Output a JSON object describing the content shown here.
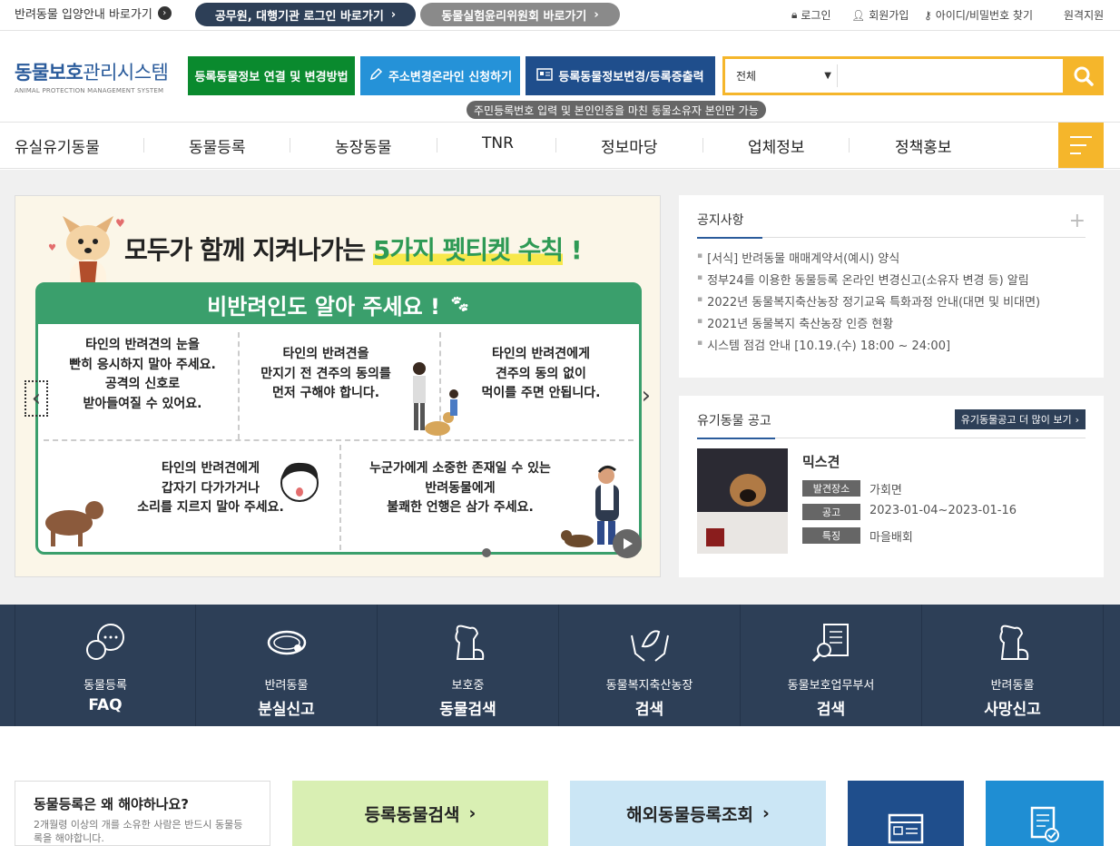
{
  "topbar": {
    "adopt_link": "반려동물 입양안내 바로가기",
    "pill_official": "공무원, 대행기관 로그인 바로가기",
    "pill_ethics": "동물실험윤리위원회 바로가기",
    "login": "로그인",
    "signup": "회원가입",
    "find": "아이디/비밀번호 찾기",
    "remote": "원격지원"
  },
  "header": {
    "logo_main_bold": "동물보호",
    "logo_main_rest": "관리시스템",
    "logo_sub": "ANIMAL PROTECTION MANAGEMENT SYSTEM",
    "btn_connect": "등록동물정보 연결 및 변경방법",
    "btn_address": "주소변경온라인 신청하기",
    "btn_change": "등록동물정보변경/등록증출력",
    "search_select": "전체",
    "search_placeholder": "",
    "hint": "주민등록번호 입력 및 본인인증을 마친 동물소유자 본인만 가능",
    "colors": {
      "green": "#0a8a2e",
      "blue": "#2592d8",
      "navy": "#1f4e8c",
      "yellow": "#f5b62b"
    }
  },
  "nav": [
    "유실유기동물",
    "동물등록",
    "농장동물",
    "TNR",
    "정보마당",
    "업체정보",
    "정책홍보"
  ],
  "banner": {
    "title_pre": "모두가 함께 지켜나가는",
    "title_hl": "5가지 펫티켓 수칙",
    "title_post": "!",
    "head": "비반려인도 알아 주세요 !",
    "cells": [
      "타인의 반려견의 눈을\n빤히 응시하지 말아 주세요.\n공격의 신호로\n받아들여질 수 있어요.",
      "타인의 반려견을\n만지기 전 견주의 동의를\n먼저 구해야 합니다.",
      "타인의 반려견에게\n견주의 동의 없이\n먹이를 주면 안됩니다.",
      "타인의 반려견에게\n갑자기 다가가거나\n소리를 지르지 말아 주세요.",
      "누군가에게 소중한 존재일 수 있는\n반려동물에게\n불쾌한 언행은 삼가 주세요."
    ]
  },
  "notice": {
    "title": "공지사항",
    "items": [
      "[서식] 반려동물 매매계약서(예시) 양식",
      "정부24를 이용한 동물등록 온라인 변경신고(소유자 변경 등) 알림",
      "2022년 동물복지축산농장 정기교육 특화과정 안내(대면 및 비대면)",
      "2021년 동물복지 축산농장 인증 현황",
      "시스템 점검 안내 [10.19.(수) 18:00 ~ 24:00]"
    ]
  },
  "lost": {
    "title": "유기동물 공고",
    "more": "유기동물공고 더 많이 보기",
    "name": "믹스견",
    "labels": [
      "발견장소",
      "공고",
      "특징"
    ],
    "values": [
      "가회면",
      "2023-01-04~2023-01-16",
      "마을배회"
    ]
  },
  "quick": [
    {
      "sm": "동물등록",
      "big": "FAQ",
      "icon": "chat-icon"
    },
    {
      "sm": "반려동물",
      "big": "분실신고",
      "icon": "collar-icon"
    },
    {
      "sm": "보호중",
      "big": "동물검색",
      "icon": "dog-icon"
    },
    {
      "sm": "동물복지축산농장",
      "big": "검색",
      "icon": "hands-leaf-icon"
    },
    {
      "sm": "동물보호업무부서",
      "big": "검색",
      "icon": "document-search-icon"
    },
    {
      "sm": "반려동물",
      "big": "사망신고",
      "icon": "dog-icon"
    }
  ],
  "bottom": {
    "why_title": "동물등록은 왜 해야하나요?",
    "why_desc": "2개월령 이상의 개를 소유한 사람은 반드시 동물등록을 해야합니다.",
    "search_btn": "등록동물검색",
    "overseas_btn": "해외동물등록조회"
  }
}
